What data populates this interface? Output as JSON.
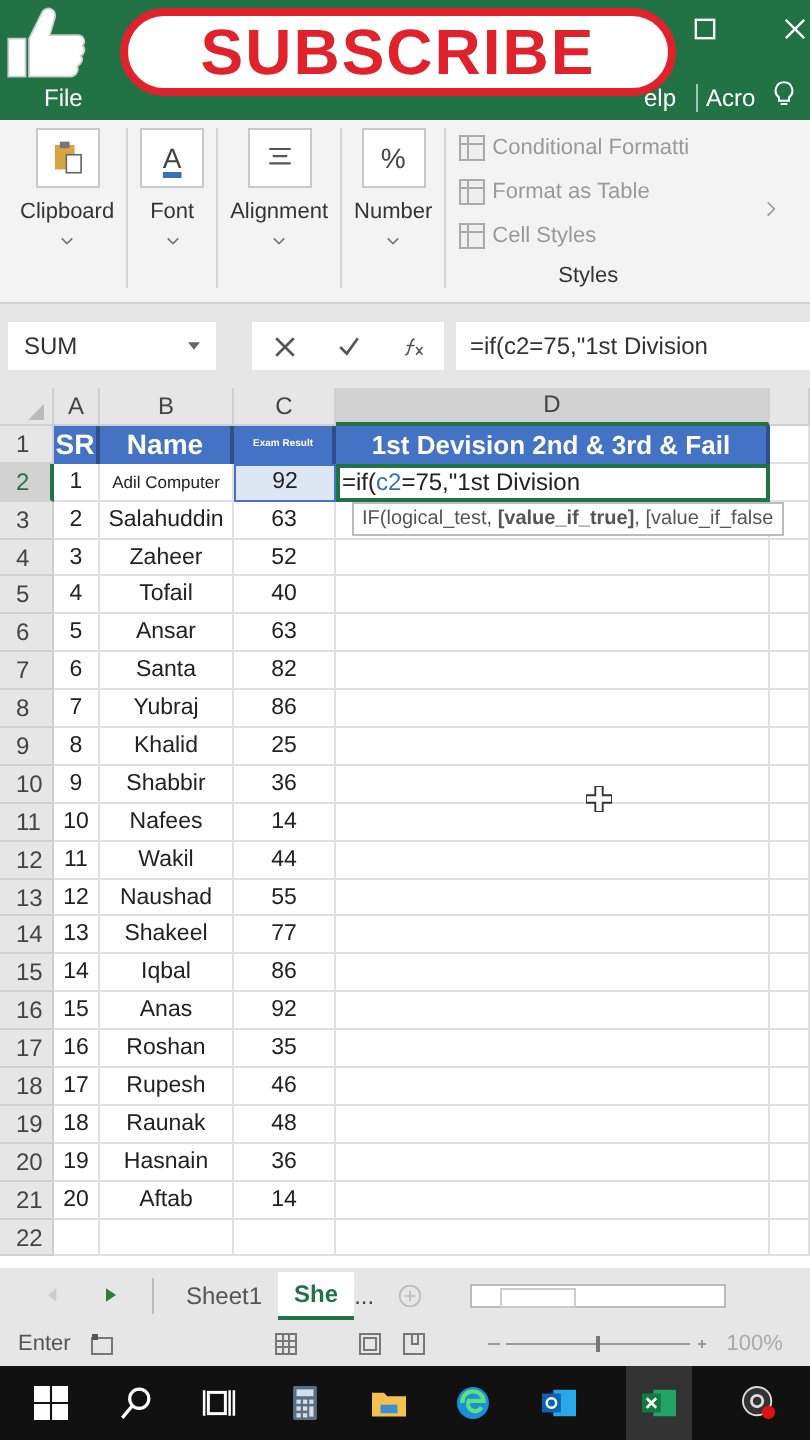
{
  "title_bar": {
    "tabs": [
      {
        "label": "File"
      },
      {
        "label": "elp"
      },
      {
        "label": "Acro"
      }
    ]
  },
  "overlay": {
    "text": "SUBSCRIBE"
  },
  "ribbon": {
    "groups": [
      {
        "label": "Clipboard",
        "kind": "paste"
      },
      {
        "label": "Font",
        "kind": "font",
        "glyph": "A"
      },
      {
        "label": "Alignment",
        "kind": "align"
      },
      {
        "label": "Number",
        "kind": "number",
        "glyph": "%"
      }
    ],
    "styles": {
      "items": [
        "Conditional Formatti",
        "Format as Table",
        "Cell Styles"
      ],
      "label": "Styles"
    }
  },
  "formula_bar": {
    "name_box": "SUM",
    "formula": "=if(c2=75,\"1st Division"
  },
  "sheet": {
    "columns": [
      {
        "label": "A",
        "selected": false
      },
      {
        "label": "B",
        "selected": false
      },
      {
        "label": "C",
        "selected": false
      },
      {
        "label": "D",
        "selected": true
      }
    ],
    "header_row": {
      "row": "1",
      "cells": [
        "SR",
        "Name",
        "Exam Result",
        "1st Devision 2nd & 3rd & Fail"
      ]
    },
    "edit_row": {
      "row": "2",
      "sr": "1",
      "name": "Adil Computer",
      "score": "92",
      "formula_parts": [
        "=if(",
        "c2",
        "=75,\"1st Division"
      ]
    },
    "tooltip": "IF(logical_test, **[value_if_true]**, [value_if_false",
    "rows": [
      {
        "row": "3",
        "sr": "2",
        "name": "Salahuddin",
        "score": "63"
      },
      {
        "row": "4",
        "sr": "3",
        "name": "Zaheer",
        "score": "52"
      },
      {
        "row": "5",
        "sr": "4",
        "name": "Tofail",
        "score": "40"
      },
      {
        "row": "6",
        "sr": "5",
        "name": "Ansar",
        "score": "63"
      },
      {
        "row": "7",
        "sr": "6",
        "name": "Santa",
        "score": "82"
      },
      {
        "row": "8",
        "sr": "7",
        "name": "Yubraj",
        "score": "86"
      },
      {
        "row": "9",
        "sr": "8",
        "name": "Khalid",
        "score": "25"
      },
      {
        "row": "10",
        "sr": "9",
        "name": "Shabbir",
        "score": "36"
      },
      {
        "row": "11",
        "sr": "10",
        "name": "Nafees",
        "score": "14"
      },
      {
        "row": "12",
        "sr": "11",
        "name": "Wakil",
        "score": "44"
      },
      {
        "row": "13",
        "sr": "12",
        "name": "Naushad",
        "score": "55"
      },
      {
        "row": "14",
        "sr": "13",
        "name": "Shakeel",
        "score": "77"
      },
      {
        "row": "15",
        "sr": "14",
        "name": "Iqbal",
        "score": "86"
      },
      {
        "row": "16",
        "sr": "15",
        "name": "Anas",
        "score": "92"
      },
      {
        "row": "17",
        "sr": "16",
        "name": "Roshan",
        "score": "35"
      },
      {
        "row": "18",
        "sr": "17",
        "name": "Rupesh",
        "score": "46"
      },
      {
        "row": "19",
        "sr": "18",
        "name": "Raunak",
        "score": "48"
      },
      {
        "row": "20",
        "sr": "19",
        "name": "Hasnain",
        "score": "36"
      },
      {
        "row": "21",
        "sr": "20",
        "name": "Aftab",
        "score": "14"
      }
    ],
    "empty_rows": [
      "22"
    ]
  },
  "sheet_tabs": {
    "tabs": [
      {
        "label": "Sheet1",
        "selected": false
      },
      {
        "label": "She",
        "selected": true
      }
    ],
    "more": "..."
  },
  "status_bar": {
    "mode": "Enter",
    "zoom": "100%",
    "zoom_slider": {
      "level": 0.5
    }
  }
}
